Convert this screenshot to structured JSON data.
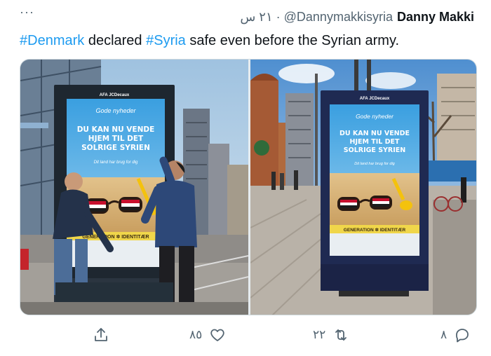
{
  "tweet": {
    "more_label": "···",
    "display_name": "Danny Makki",
    "handle": "@Dannymakkisyria",
    "separator": "·",
    "timestamp": "٢١ س",
    "text": {
      "hashtag1": "#Denmark",
      "part1": " declared ",
      "hashtag2": "#Syria",
      "part2": " safe even before the Syrian army."
    },
    "media": {
      "poster": {
        "brand": "AFA JCDecaux",
        "kicker": "Gode nyheder",
        "headline1": "DU KAN NU VENDE",
        "headline2": "HJEM TIL DET",
        "headline3": "SOLRIGE SYRIEN",
        "subline": "Dit land har brug for dig",
        "footer": "GENERATION ✲ IDENTITÆR"
      }
    },
    "actions": {
      "reply_count": "٨",
      "retweet_count": "٢٢",
      "like_count": "٨٥"
    }
  },
  "colors": {
    "accent": "#1d9bf0",
    "secondary_text": "#536471",
    "primary_text": "#0f1419"
  }
}
